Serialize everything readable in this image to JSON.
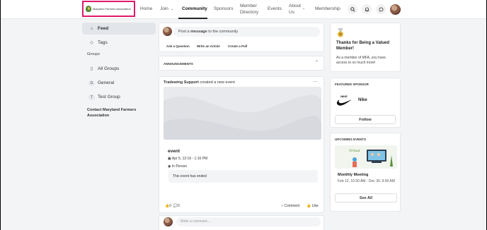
{
  "brand": {
    "name": "Maryland Farmers Association"
  },
  "nav": {
    "items": [
      {
        "label": "Home"
      },
      {
        "label": "Join"
      },
      {
        "label": "Community"
      },
      {
        "label": "Sponsors"
      },
      {
        "label": "Member Directory"
      },
      {
        "label": "Events"
      },
      {
        "label": "About Us"
      },
      {
        "label": "Membership"
      }
    ],
    "active": "Community",
    "dropdown_icon": "chevron-down-icon",
    "icons": [
      "search-icon",
      "bell-icon",
      "chat-icon"
    ]
  },
  "sidebar": {
    "items": [
      {
        "label": "Feed",
        "icon": "home-icon"
      },
      {
        "label": "Tags",
        "icon": "tag-icon"
      }
    ],
    "groups_heading": "Groups",
    "groups": [
      {
        "label": "All Groups",
        "icon": "book-icon"
      },
      {
        "label": "General",
        "icon": "G"
      },
      {
        "label": "Test Group",
        "icon": "T"
      }
    ],
    "contact": "Contact Maryland Farmers Association"
  },
  "composer": {
    "placeholder_pre": "Post a ",
    "placeholder_bold": "message",
    "placeholder_post": " to the community",
    "actions": [
      "Ask a Question",
      "Write an Article",
      "Create a Poll"
    ]
  },
  "announcements": {
    "label": "ANNOUNCEMENTS"
  },
  "post": {
    "author": "Tradewing Support",
    "action": "created a new event",
    "event": {
      "title": "event",
      "datetime": "Apr 5, 12:16 - 1:16 PM",
      "location": "In Person",
      "status": "This event has ended"
    },
    "reactions": {
      "likes": "0",
      "comments": "0"
    },
    "comment_label": "Comment",
    "like_label": "Like"
  },
  "comment_box": {
    "placeholder": "Write a comment..."
  },
  "right": {
    "welcome": {
      "title": "Thanks for Being a Valued Member!",
      "body": "As a member of MFA, you have access to so much more!"
    },
    "sponsor": {
      "heading": "FEATURED SPONSOR",
      "name": "Nike",
      "follow": "Follow"
    },
    "events": {
      "heading": "UPCOMING EVENTS",
      "title": "Monthly Meeting",
      "dates": "Feb 12, 10:30 AM - Dec 30, 9:00 AM",
      "see_all": "See All"
    }
  },
  "colors": {
    "highlight": "#e0186c",
    "accent": "#222222"
  }
}
